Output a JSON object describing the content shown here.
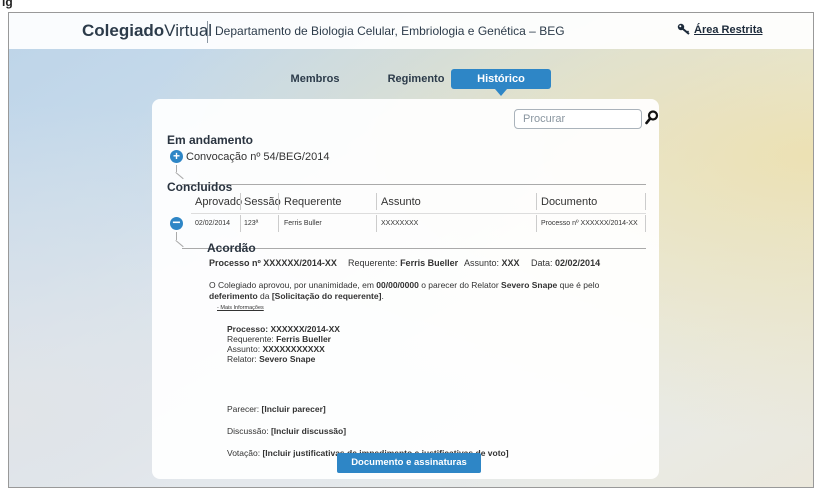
{
  "top_fragment": "ig",
  "header": {
    "brand_bold": "Colegiado",
    "brand_rest": "Virtual",
    "department": "Departamento de Biologia Celular, Embriologia e Genética – BEG",
    "restricted_link": "Área Restrita"
  },
  "tabs": [
    {
      "label": "Membros",
      "active": false
    },
    {
      "label": "Regimento",
      "active": false
    },
    {
      "label": "Histórico",
      "active": true
    }
  ],
  "search": {
    "placeholder": "Procurar"
  },
  "in_progress": {
    "title": "Em andamento",
    "item": "Convocação nº 54/BEG/2014"
  },
  "concluded": {
    "title": "Concluidos",
    "columns": [
      "Aprovado",
      "Sessão",
      "Requerente",
      "Assunto",
      "Documento"
    ],
    "row": {
      "aprovado": "02/02/2014",
      "sessao": "123ª",
      "requerente": "Ferris Buller",
      "assunto": "XXXXXXXX",
      "documento": "Processo nº XXXXXX/2014-XX"
    }
  },
  "acordao": {
    "title": "Acordão",
    "processo": "Processo nº XXXXXX/2014-XX",
    "requerente_label": "Requerente:",
    "requerente_value": "Ferris Bueller",
    "assunto_label": "Assunto:",
    "assunto_value": "XXX",
    "data_label": "Data:",
    "data_value": "02/02/2014",
    "paragraph": {
      "t1": "O Colegiado aprovou, por unanimidade, em ",
      "b1": "00/00/0000",
      "t2": " o parecer do Relator ",
      "b2": "Severo Snape",
      "t3": " que é pelo ",
      "b3": "deferimento",
      "t4": "  da ",
      "b4": "[Solicitação do requerente]",
      "t5": "."
    },
    "more_info": "- Mais Informações",
    "details": {
      "processo_label": "Processo:",
      "processo_value": "XXXXXX/2014-XX",
      "requerente_label": "Requerente:",
      "requerente_value": "Ferris Bueller",
      "assunto_label": "Assunto:",
      "assunto_value": "XXXXXXXXXXX",
      "relator_label": "Relator:",
      "relator_value": "Severo Snape"
    },
    "parecer_label": "Parecer:",
    "parecer_value": "[Incluir parecer]",
    "discussao_label": "Discussão:",
    "discussao_value": "[Incluir discussão]",
    "votacao_label": "Votação:",
    "votacao_value": "[Incluir justificativas de impedimento e justificativas de voto]",
    "button": "Documento e assinaturas"
  }
}
